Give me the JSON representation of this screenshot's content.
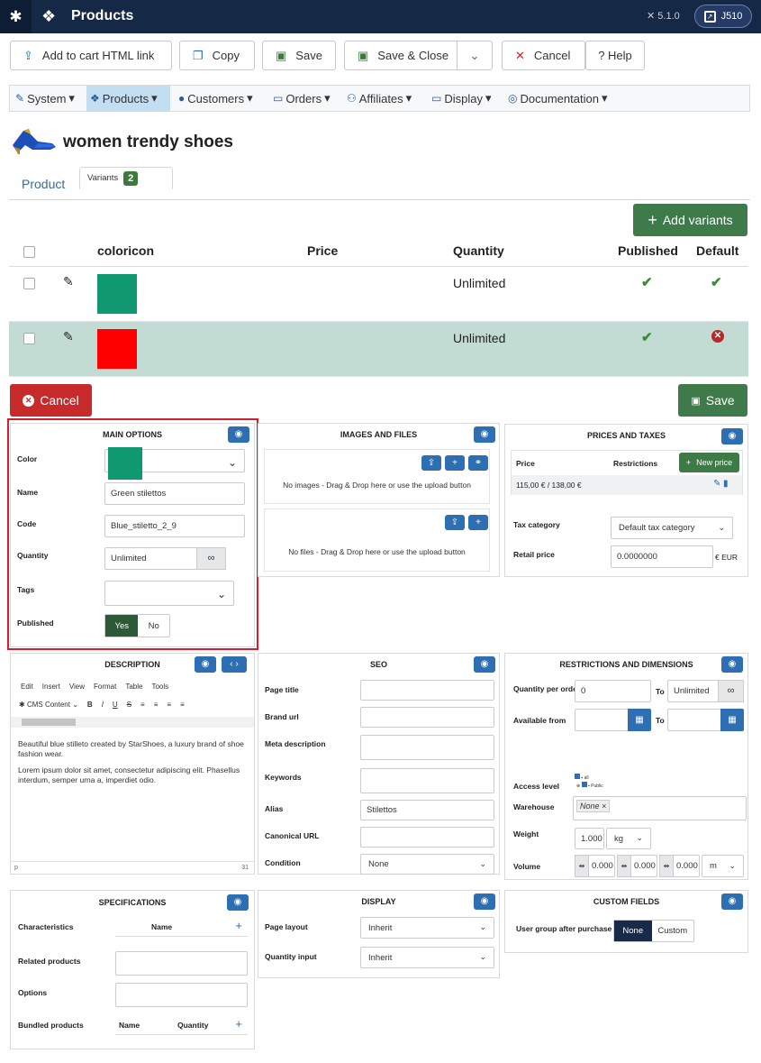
{
  "topbar": {
    "title": "Products",
    "version": "5.1.0",
    "user": "J510"
  },
  "toolbar": {
    "add_cart": "Add to cart HTML link",
    "copy": "Copy",
    "save": "Save",
    "save_close": "Save & Close",
    "cancel": "Cancel",
    "help": "? Help"
  },
  "menu": [
    "System",
    "Products",
    "Customers",
    "Orders",
    "Affiliates",
    "Display",
    "Documentation"
  ],
  "product": {
    "title": "women trendy shoes"
  },
  "tabs": {
    "product": "Product",
    "variants": "Variants",
    "variants_count": "2"
  },
  "variants": {
    "add_label": "Add variants",
    "headers": {
      "color": "coloricon",
      "price": "Price",
      "quantity": "Quantity",
      "published": "Published",
      "default": "Default"
    },
    "rows": [
      {
        "color": "#109970",
        "quantity": "Unlimited"
      },
      {
        "color": "#ff0000",
        "quantity": "Unlimited"
      }
    ]
  },
  "actions": {
    "cancel": "Cancel",
    "save": "Save"
  },
  "main_options": {
    "title": "MAIN OPTIONS",
    "color_label": "Color",
    "color_value": "#109970",
    "name_label": "Name",
    "name_value": "Green stilettos",
    "code_label": "Code",
    "code_value": "Blue_stiletto_2_9",
    "quantity_label": "Quantity",
    "quantity_value": "Unlimited",
    "tags_label": "Tags",
    "published_label": "Published",
    "yes": "Yes",
    "no": "No"
  },
  "images": {
    "title": "IMAGES AND FILES",
    "no_images": "No images - Drag & Drop here or use the upload button",
    "no_files": "No files - Drag & Drop here or use the upload button"
  },
  "prices": {
    "title": "PRICES AND TAXES",
    "price_col": "Price",
    "restrictions_col": "Restrictions",
    "new_price": "New price",
    "price_value": "115,00 € / 138,00 €",
    "tax_label": "Tax category",
    "tax_value": "Default tax category",
    "retail_label": "Retail price",
    "retail_value": "0.0000000",
    "retail_unit": "€ EUR"
  },
  "description": {
    "title": "DESCRIPTION",
    "menu": [
      "Edit",
      "Insert",
      "View",
      "Format",
      "Table",
      "Tools"
    ],
    "cms": "CMS Content",
    "p1": "Beautiful blue stilleto created by StarShoes, a luxury brand of shoe fashion wear.",
    "p2": "Lorem ipsum dolor sit amet, consectetur adipiscing elit. Phasellus interdum, semper urna a, imperdiet odio.",
    "status_p": "p",
    "status_words": "31"
  },
  "seo": {
    "title": "SEO",
    "page_title": "Page title",
    "brand_url": "Brand url",
    "meta_description": "Meta description",
    "keywords": "Keywords",
    "alias": "Alias",
    "alias_value": "Stilettos",
    "canonical": "Canonical URL",
    "condition": "Condition",
    "condition_value": "None"
  },
  "restrictions": {
    "title": "RESTRICTIONS AND DIMENSIONS",
    "qty_per_order": "Quantity per order",
    "qty_from": "0",
    "to": "To",
    "qty_to": "Unlimited",
    "available_from": "Available from",
    "access_level": "Access level",
    "access_all": "all",
    "access_public": "Public",
    "warehouse": "Warehouse",
    "warehouse_value": "None",
    "weight": "Weight",
    "weight_value": "1.000",
    "weight_unit": "kg",
    "volume": "Volume",
    "vol1": "0.000",
    "vol2": "0.000",
    "vol3": "0.000",
    "vol_unit": "m"
  },
  "specifications": {
    "title": "SPECIFICATIONS",
    "characteristics": "Characteristics",
    "name_col": "Name",
    "related": "Related products",
    "options": "Options",
    "bundled": "Bundled products",
    "bundled_name": "Name",
    "bundled_qty": "Quantity"
  },
  "display": {
    "title": "DISPLAY",
    "page_layout": "Page layout",
    "page_layout_value": "Inherit",
    "qty_input": "Quantity input",
    "qty_input_value": "Inherit"
  },
  "custom_fields": {
    "title": "CUSTOM FIELDS",
    "user_group": "User group after purchase",
    "none": "None",
    "custom": "Custom"
  }
}
